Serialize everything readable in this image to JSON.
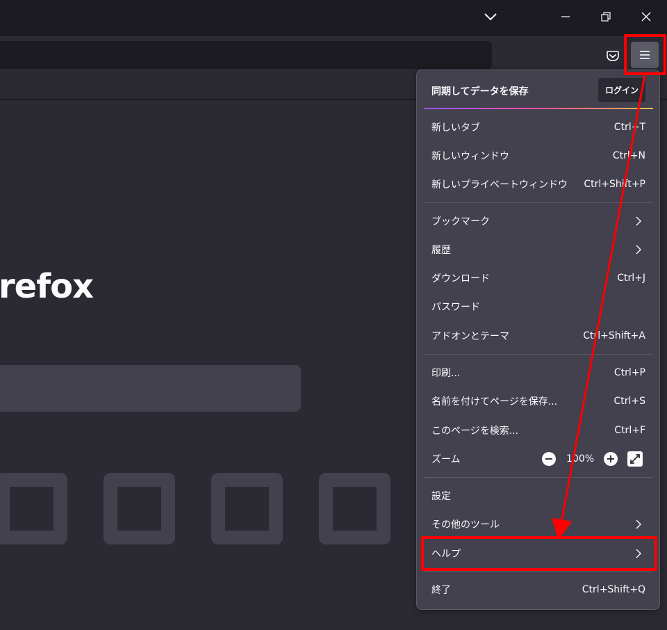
{
  "window_controls": [
    "tab-list",
    "minimize",
    "restore",
    "close"
  ],
  "page": {
    "brand_text": "refox"
  },
  "menu": {
    "sync": {
      "title": "同期してデータを保存",
      "login_label": "ログイン"
    },
    "items": [
      {
        "label": "新しいタブ",
        "shortcut": "Ctrl+T"
      },
      {
        "label": "新しいウィンドウ",
        "shortcut": "Ctrl+N"
      },
      {
        "label": "新しいプライベートウィンドウ",
        "shortcut": "Ctrl+Shift+P"
      },
      {
        "label": "ブックマーク",
        "shortcut": ""
      },
      {
        "label": "履歴",
        "shortcut": ""
      },
      {
        "label": "ダウンロード",
        "shortcut": "Ctrl+J"
      },
      {
        "label": "パスワード",
        "shortcut": ""
      },
      {
        "label": "アドオンとテーマ",
        "shortcut": "Ctrl+Shift+A"
      },
      {
        "label": "印刷...",
        "shortcut": "Ctrl+P"
      },
      {
        "label": "名前を付けてページを保存...",
        "shortcut": "Ctrl+S"
      },
      {
        "label": "このページを検索...",
        "shortcut": "Ctrl+F"
      },
      {
        "label": "ズーム",
        "shortcut": ""
      },
      {
        "label": "設定",
        "shortcut": ""
      },
      {
        "label": "その他のツール",
        "shortcut": ""
      },
      {
        "label": "ヘルプ",
        "shortcut": ""
      },
      {
        "label": "終了",
        "shortcut": "Ctrl+Shift+Q"
      }
    ],
    "zoom": {
      "value": "100%",
      "minus": "−",
      "plus": "+"
    }
  },
  "annotation": {
    "color": "#ff0000"
  }
}
